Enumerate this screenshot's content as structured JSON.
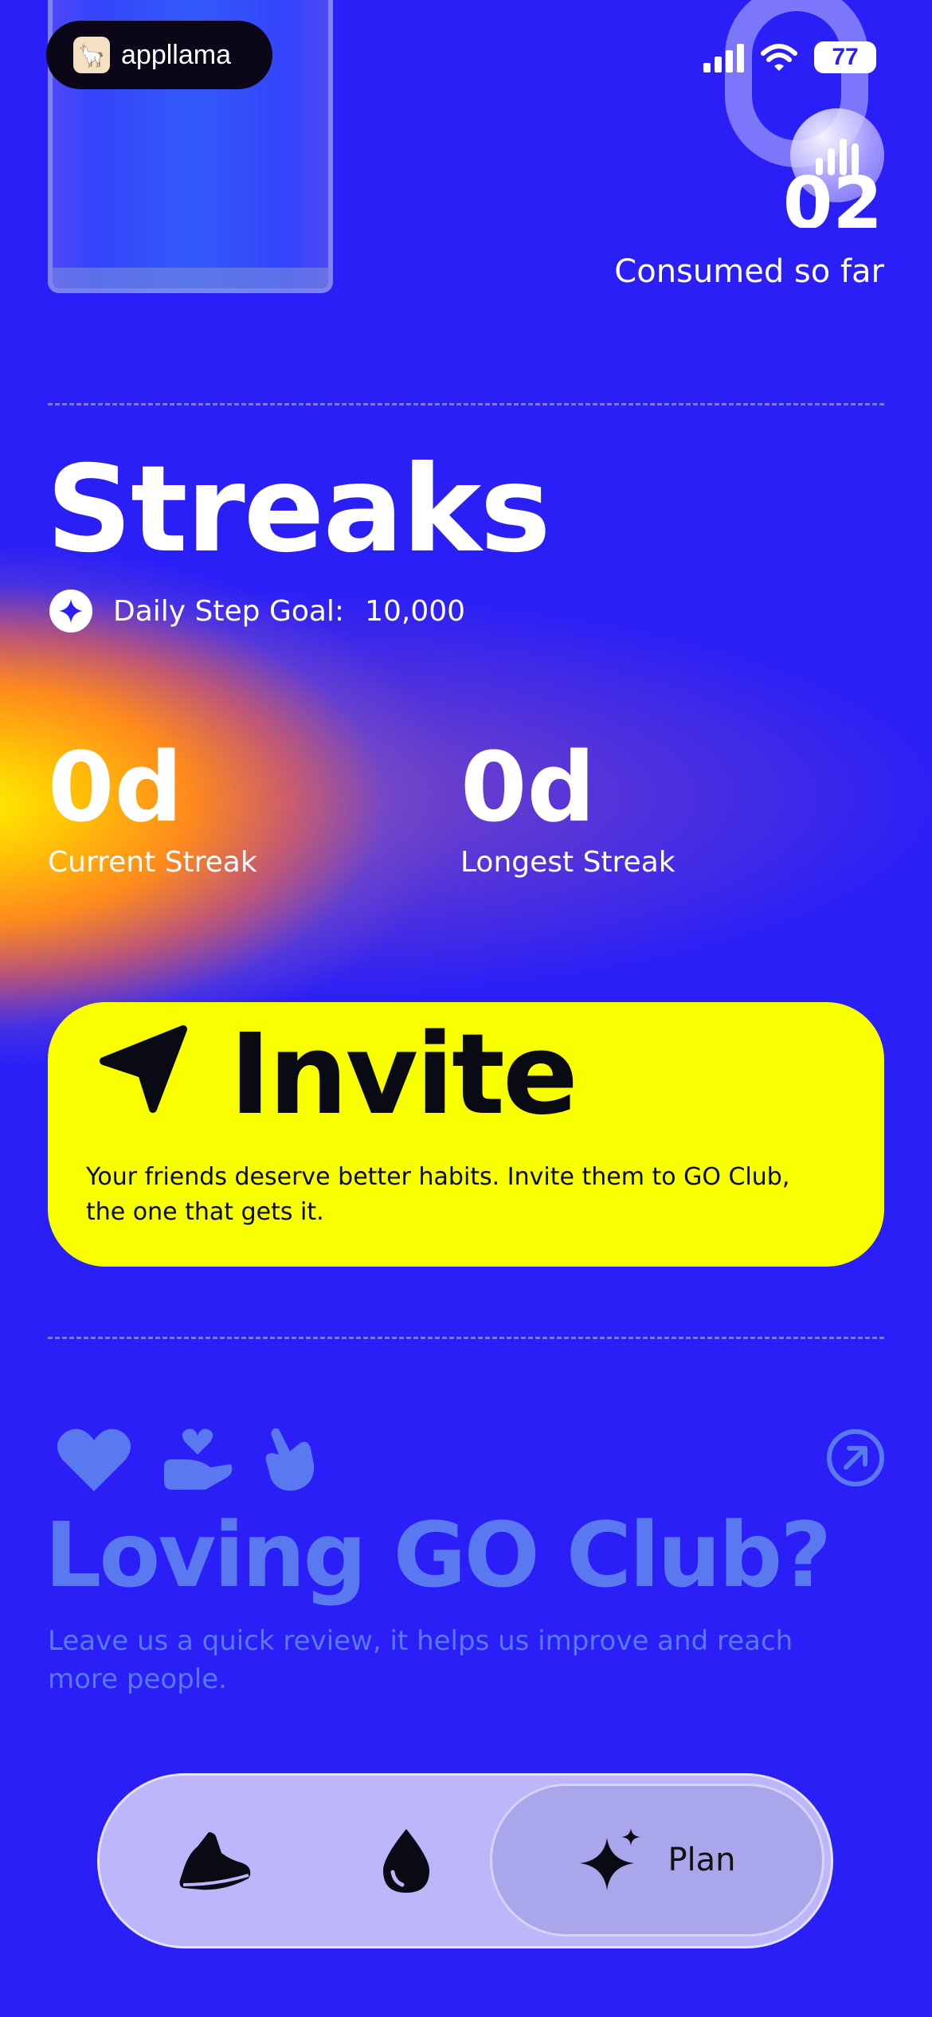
{
  "brand": {
    "name": "appllama",
    "logo_icon": "llama-logo-icon"
  },
  "status_bar": {
    "battery": "77"
  },
  "hydration": {
    "consumed_value": "02",
    "consumed_label": "Consumed so far"
  },
  "streaks": {
    "title": "Streaks",
    "goal_label": "Daily Step Goal:",
    "goal_value": "10,000",
    "current_value": "0d",
    "current_label": "Current Streak",
    "longest_value": "0d",
    "longest_label": "Longest Streak"
  },
  "invite": {
    "title": "Invite",
    "text": "Your friends deserve better habits. Invite them to GO Club, the one that gets it."
  },
  "review": {
    "title": "Loving GO Club?",
    "text": "Leave us a quick review, it helps us improve and reach more people."
  },
  "tabs": [
    {
      "icon": "sneaker-icon"
    },
    {
      "icon": "water-drop-icon"
    },
    {
      "icon": "sparkle-icon",
      "label": "Plan",
      "active": true
    }
  ],
  "colors": {
    "background": "#2a1ff6",
    "invite_card": "#f8ff00",
    "review_accent": "#5a78f0",
    "tab_bar": "#bdb6fb"
  }
}
